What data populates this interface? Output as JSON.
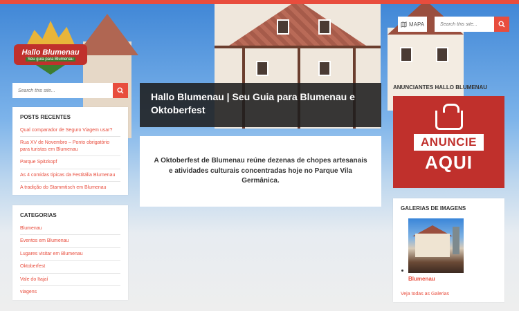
{
  "brand": {
    "logo_title": "Hallo Blumenau",
    "logo_tagline": "Seu guia para Blumenau",
    "accent": "#e84d3d"
  },
  "header": {
    "map_label": "MAPA",
    "map_icon": "map-icon",
    "search_placeholder": "Search this site..."
  },
  "sidebar_left": {
    "search_placeholder": "Search this site...",
    "recent_posts": {
      "title": "POSTS RECENTES",
      "items": [
        "Qual comparador de Seguro Viagem usar?",
        "Rua XV de Novembro – Ponto obrigatório para turistas em Blumenau",
        "Parque Spitzkopf",
        "As 4 comidas típicas da Festitália Blumenau",
        "A tradição do Stammtisch em Blumenau"
      ]
    },
    "categories": {
      "title": "CATEGORIAS",
      "items": [
        "Blumenau",
        "Eventos em Blumenau",
        "Lugares visitar em Blumenau",
        "Oktoberfest",
        "Vale do Itajaí",
        "viagens"
      ]
    }
  },
  "main": {
    "title": "Hallo Blumenau | Seu Guia para Blumenau e Oktoberfest",
    "intro": "A Oktoberfest de Blumenau reúne dezenas de chopes artesanais e atividades culturais concentradas hoje no Parque Vila Germânica."
  },
  "sidebar_right": {
    "ads_title": "ANUNCIANTES HALLO BLUMENAU",
    "ad_banner": "ANUNCIE",
    "ad_big": "AQUI",
    "gallery_title": "GALERIAS DE IMAGENS",
    "gallery_item": "Blumenau",
    "gallery_link": "Veja todas as Galerias"
  }
}
